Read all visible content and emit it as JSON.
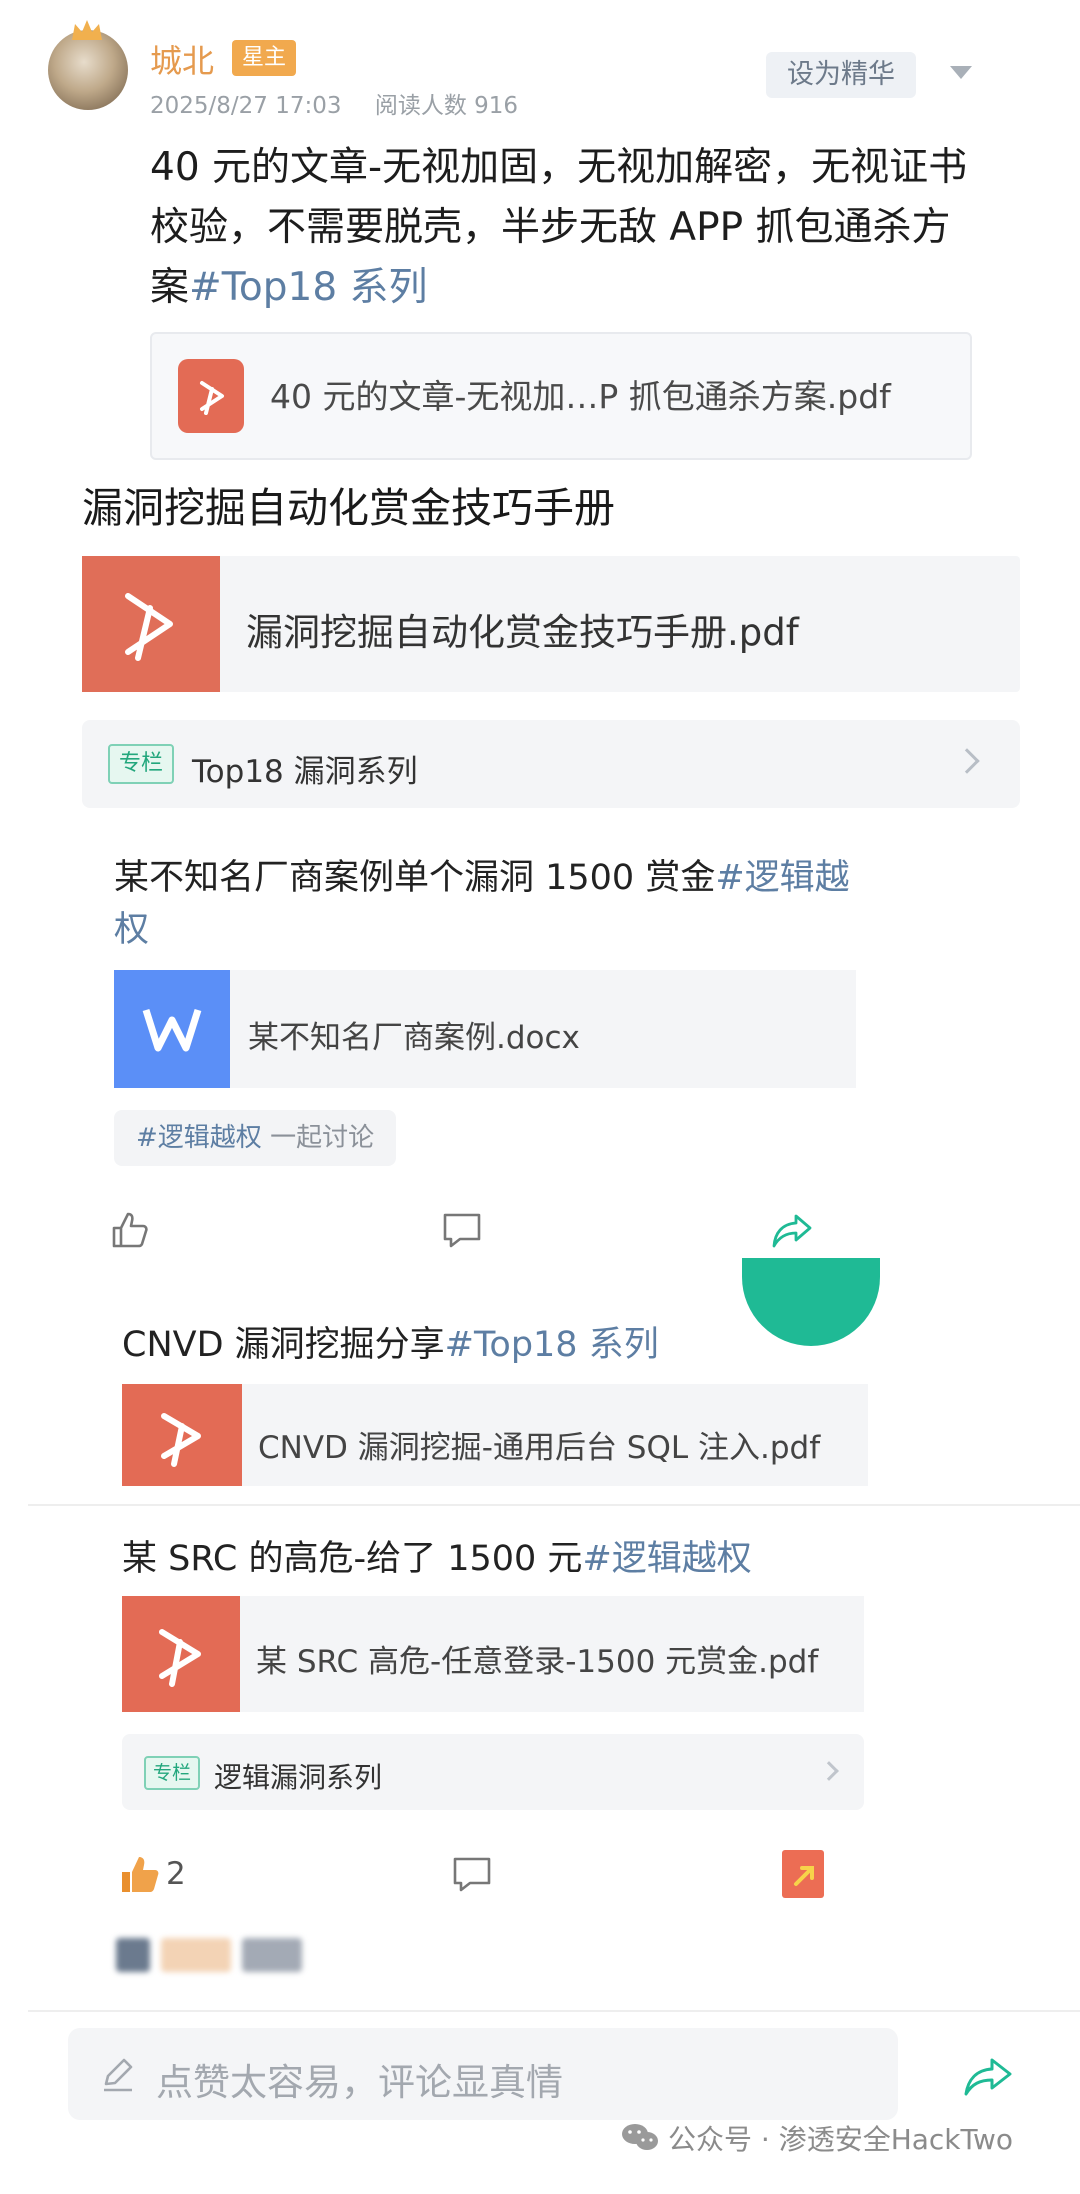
{
  "author": {
    "name": "城北",
    "badge": "星主",
    "date": "2025/8/27 17:03",
    "reads": "阅读人数 916",
    "feature_button": "设为精华"
  },
  "post": {
    "text": "40 元的文章-无视加固，无视加解密，无视证书校验，不需要脱壳，半步无敌 APP 抓包通杀方案",
    "tag": "#Top18 系列",
    "file_name": "40 元的文章-无视加…P 抓包通杀方案.pdf"
  },
  "handbook": {
    "title": "漏洞挖掘自动化赏金技巧手册",
    "file_name": "漏洞挖掘自动化赏金技巧手册.pdf"
  },
  "column": {
    "tag": "专栏",
    "name": "Top18 漏洞系列"
  },
  "post2": {
    "text": "某不知名厂商案例单个漏洞 1500 赏金",
    "tag": "#逻辑越权",
    "file_name": "某不知名厂商案例.docx",
    "discuss_tag": "#逻辑越权",
    "discuss_label": "一起讨论"
  },
  "post3": {
    "text": "CNVD 漏洞挖掘分享",
    "tag": "#Top18 系列",
    "file_name": "CNVD 漏洞挖掘-通用后台 SQL 注入.pdf"
  },
  "post4": {
    "text": "某 SRC 的高危-给了 1500 元",
    "tag": "#逻辑越权",
    "file_name": "某 SRC 高危-任意登录-1500 元赏金.pdf",
    "column_tag": "专栏",
    "column_name": "逻辑漏洞系列",
    "like_count": "2"
  },
  "comment_bar": {
    "placeholder": "点赞太容易，评论显真情"
  },
  "watermark": {
    "text": "公众号 · 渗透安全HackTwo"
  },
  "colors": {
    "accent_orange": "#e59a4e",
    "tag_blue": "#5d7ea3",
    "pdf_red": "#e36b55",
    "word_blue": "#5b8ff7",
    "green": "#1fba95"
  }
}
